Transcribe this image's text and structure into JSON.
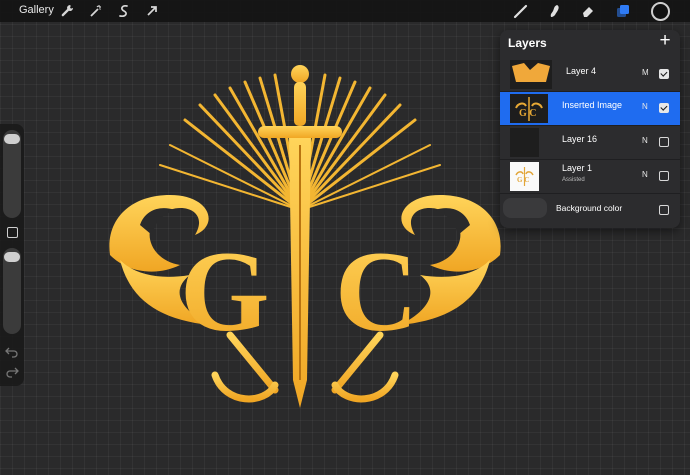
{
  "topbar": {
    "gallery_label": "Gallery",
    "left_icons": [
      "wrench-icon",
      "magic-wand-icon",
      "selection-icon",
      "transform-arrow-icon"
    ],
    "right_tools": [
      "brush-icon",
      "smudge-icon",
      "eraser-icon",
      "layers-icon"
    ],
    "active_tool_color": "#2f7bf5",
    "current_color": "#111111"
  },
  "canvas": {
    "background": "#2a2a2b",
    "artwork_color": "#f5b52e",
    "artwork_letters": [
      "G",
      "C"
    ]
  },
  "layers_panel": {
    "title": "Layers",
    "add_icon": "+",
    "layers": [
      {
        "name": "Layer 4",
        "blend": "M",
        "visible": true,
        "selected": false,
        "subtitle": ""
      },
      {
        "name": "Inserted Image",
        "blend": "N",
        "visible": true,
        "selected": true,
        "subtitle": ""
      },
      {
        "name": "Layer 16",
        "blend": "N",
        "visible": false,
        "selected": false,
        "subtitle": ""
      },
      {
        "name": "Layer 1",
        "blend": "N",
        "visible": false,
        "selected": false,
        "subtitle": "Assisted"
      }
    ],
    "background_label": "Background color",
    "background_visible": false
  }
}
